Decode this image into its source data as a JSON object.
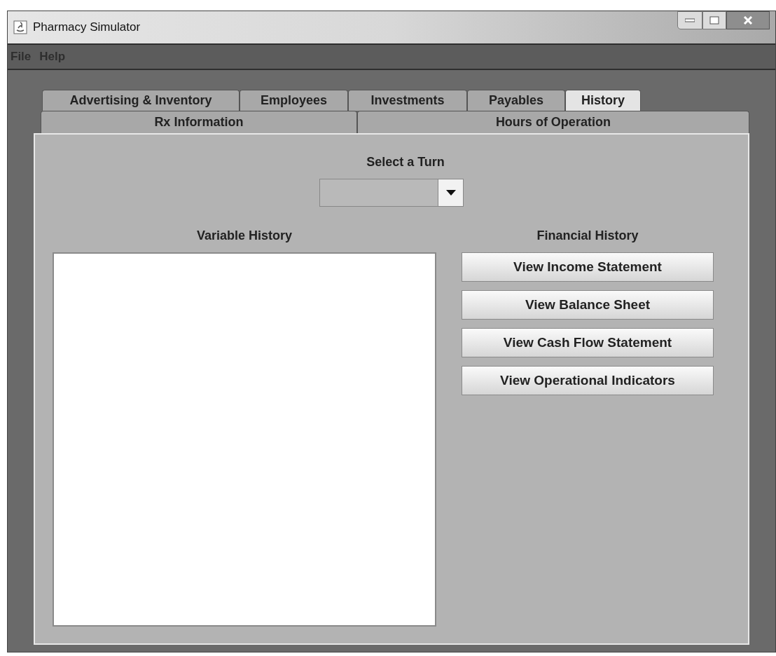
{
  "window": {
    "title": "Pharmacy Simulator"
  },
  "menu": [
    "File",
    "Help"
  ],
  "tab_rows": [
    [
      {
        "label": "Advertising & Inventory",
        "selected": false
      },
      {
        "label": "Employees",
        "selected": false
      },
      {
        "label": "Investments",
        "selected": false
      },
      {
        "label": "Payables",
        "selected": false
      },
      {
        "label": "History",
        "selected": true
      }
    ],
    [
      {
        "label": "Rx Information",
        "selected": false
      },
      {
        "label": "Hours of Operation",
        "selected": false
      }
    ]
  ],
  "turn": {
    "label": "Select a Turn"
  },
  "variable_history": {
    "label": "Variable History"
  },
  "financial_history": {
    "label": "Financial History",
    "buttons": [
      "View Income Statement",
      "View Balance Sheet",
      "View Cash Flow Statement",
      "View Operational Indicators"
    ]
  }
}
